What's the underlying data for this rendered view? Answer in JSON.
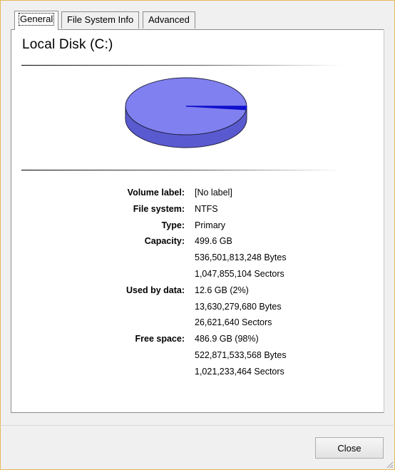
{
  "tabs": [
    {
      "label": "General",
      "active": true
    },
    {
      "label": "File System Info",
      "active": false
    },
    {
      "label": "Advanced",
      "active": false
    }
  ],
  "disk_title": "Local Disk (C:)",
  "chart_data": {
    "type": "pie",
    "slices": [
      {
        "label": "Used by data",
        "percent": 2,
        "color": "#1010cc"
      },
      {
        "label": "Free space",
        "percent": 98,
        "color": "#8080f0"
      }
    ]
  },
  "info": [
    {
      "label": "Volume label:",
      "values": [
        "[No label]"
      ]
    },
    {
      "label": "File system:",
      "values": [
        "NTFS"
      ]
    },
    {
      "label": "Type:",
      "values": [
        "Primary"
      ]
    },
    {
      "label": "Capacity:",
      "values": [
        "499.6 GB",
        "536,501,813,248 Bytes",
        "1,047,855,104 Sectors"
      ]
    },
    {
      "label": "Used by data:",
      "values": [
        "12.6 GB (2%)",
        "13,630,279,680 Bytes",
        "26,621,640 Sectors"
      ]
    },
    {
      "label": "Free space:",
      "values": [
        "486.9 GB (98%)",
        "522,871,533,568 Bytes",
        "1,021,233,464 Sectors"
      ]
    }
  ],
  "close_label": "Close"
}
